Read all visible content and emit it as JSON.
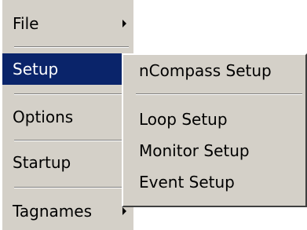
{
  "menu": {
    "items": [
      {
        "label": "File",
        "has_submenu": true
      },
      {
        "label": "Setup",
        "has_submenu": false,
        "selected": true
      },
      {
        "label": "Options",
        "has_submenu": false
      },
      {
        "label": "Startup",
        "has_submenu": false
      },
      {
        "label": "Tagnames",
        "has_submenu": true
      }
    ]
  },
  "submenu": {
    "items": [
      {
        "label": "nCompass Setup"
      },
      {
        "label": "Loop Setup"
      },
      {
        "label": "Monitor Setup"
      },
      {
        "label": "Event Setup"
      }
    ]
  },
  "colors": {
    "menu_background": "#d4d0c8",
    "selection_background": "#0a246a",
    "selection_text": "#ffffff"
  }
}
